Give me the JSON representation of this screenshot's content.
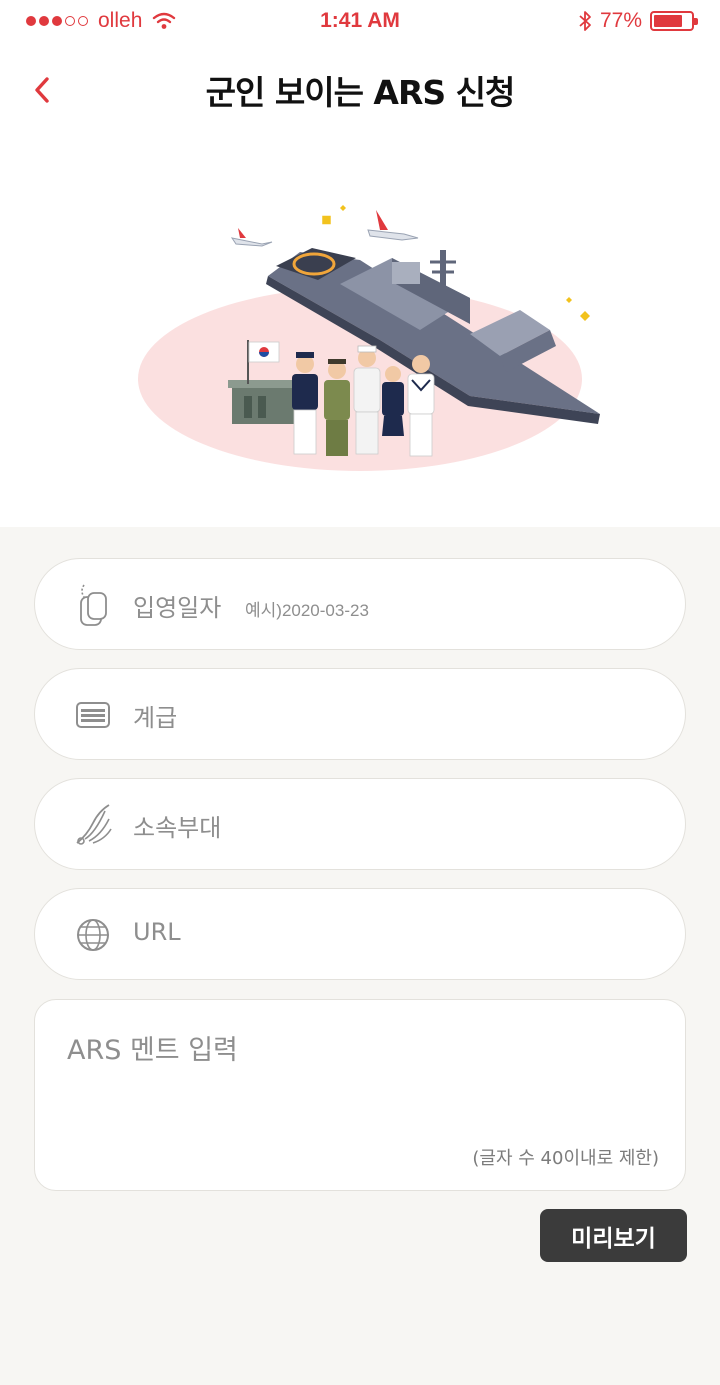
{
  "status_bar": {
    "carrier": "olleh",
    "time": "1:41 AM",
    "battery": "77%",
    "battery_level": 0.77
  },
  "header": {
    "title": "군인 보이는 ARS 신청"
  },
  "form": {
    "enlist_date": {
      "label": "입영일자",
      "hint": "예시)2020-03-23",
      "icon": "dog-tag-icon"
    },
    "rank": {
      "label": "계급",
      "icon": "rank-icon"
    },
    "unit": {
      "label": "소속부대",
      "icon": "wing-icon"
    },
    "url": {
      "label": "URL",
      "icon": "globe-icon"
    },
    "ars": {
      "placeholder": "ARS 멘트 입력",
      "limit": "(글자 수 40이내로 제한)"
    },
    "preview_label": "미리보기"
  },
  "colors": {
    "accent": "#e0393e",
    "button_dark": "#3b3b3b",
    "page_bg": "#f7f6f3"
  }
}
